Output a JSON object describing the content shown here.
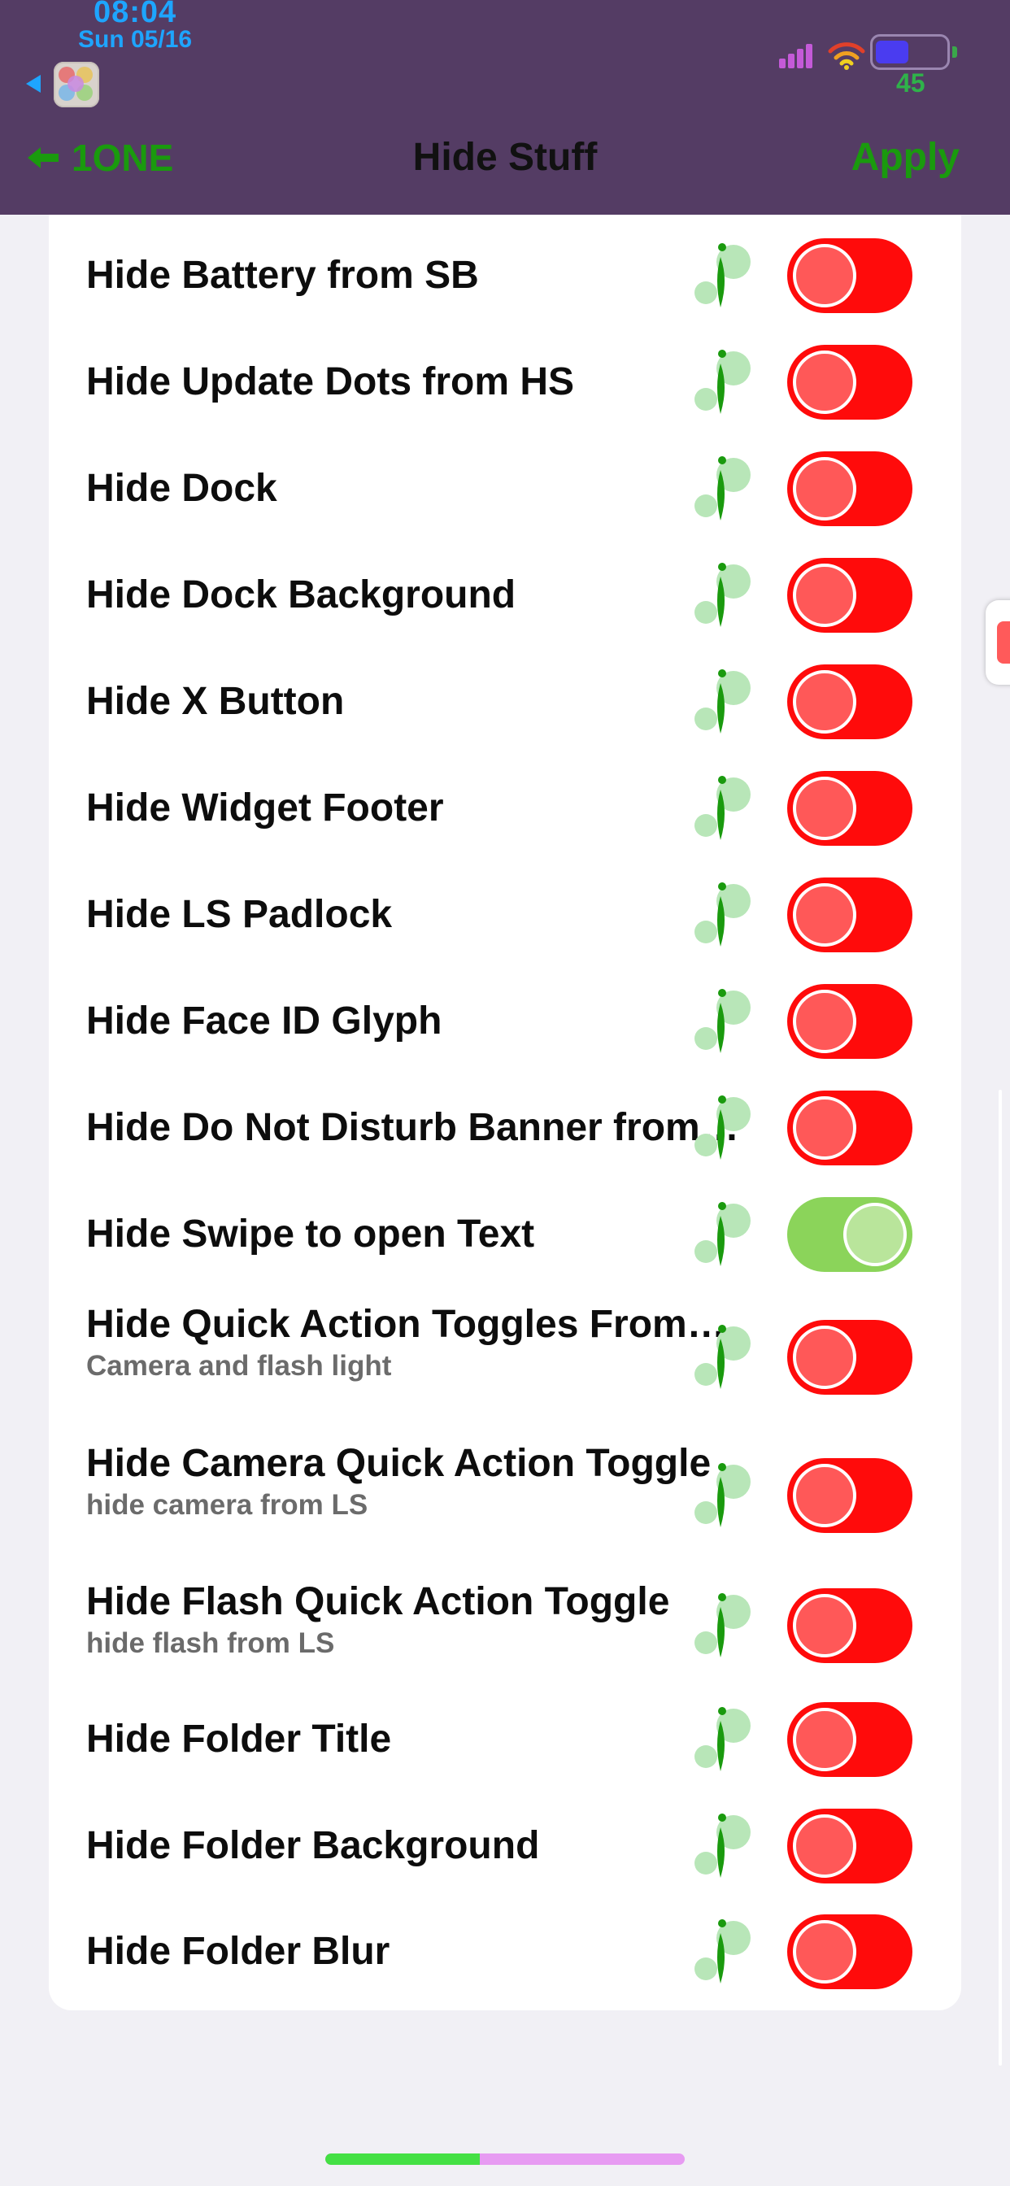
{
  "status_bar": {
    "time": "08:04",
    "date": "Sun 05/16",
    "battery_percent": "45",
    "battery_level": 0.45,
    "colors": {
      "time": "#1ea5ff",
      "battery_text": "#2fb24a"
    }
  },
  "nav": {
    "back_label": "1ONE",
    "title": "Hide Stuff",
    "apply_label": "Apply",
    "accent": "#1a9a0e",
    "background": "#543c64"
  },
  "settings": [
    {
      "title": "Hide Battery from SB",
      "subtitle": "",
      "on": false
    },
    {
      "title": "Hide Update Dots from HS",
      "subtitle": "",
      "on": false
    },
    {
      "title": "Hide Dock",
      "subtitle": "",
      "on": false
    },
    {
      "title": "Hide Dock Background",
      "subtitle": "",
      "on": false
    },
    {
      "title": "Hide X Button",
      "subtitle": "",
      "on": false
    },
    {
      "title": "Hide Widget Footer",
      "subtitle": "",
      "on": false
    },
    {
      "title": "Hide LS Padlock",
      "subtitle": "",
      "on": false
    },
    {
      "title": "Hide Face ID Glyph",
      "subtitle": "",
      "on": false
    },
    {
      "title": "Hide Do Not Disturb Banner from…",
      "subtitle": "",
      "on": false
    },
    {
      "title": "Hide Swipe to open Text",
      "subtitle": "",
      "on": true
    },
    {
      "title": "Hide Quick Action Toggles From…",
      "subtitle": "Camera and flash light",
      "on": false
    },
    {
      "title": "Hide Camera Quick Action Toggle",
      "subtitle": "hide camera from LS",
      "on": false
    },
    {
      "title": "Hide Flash Quick Action Toggle",
      "subtitle": "hide flash from LS",
      "on": false
    },
    {
      "title": "Hide Folder Title",
      "subtitle": "",
      "on": false
    },
    {
      "title": "Hide Folder Background",
      "subtitle": "",
      "on": false
    },
    {
      "title": "Hide Folder Blur",
      "subtitle": "",
      "on": false
    }
  ],
  "toggle_colors": {
    "off": "#ff0b0b",
    "on": "#8bd45a"
  },
  "icons": {
    "row_info": "info-icon",
    "back": "arrow-left-icon",
    "wifi": "wifi-icon",
    "signal": "cellular-signal-icon",
    "battery": "battery-icon"
  },
  "home_indicator_progress": 0.43
}
